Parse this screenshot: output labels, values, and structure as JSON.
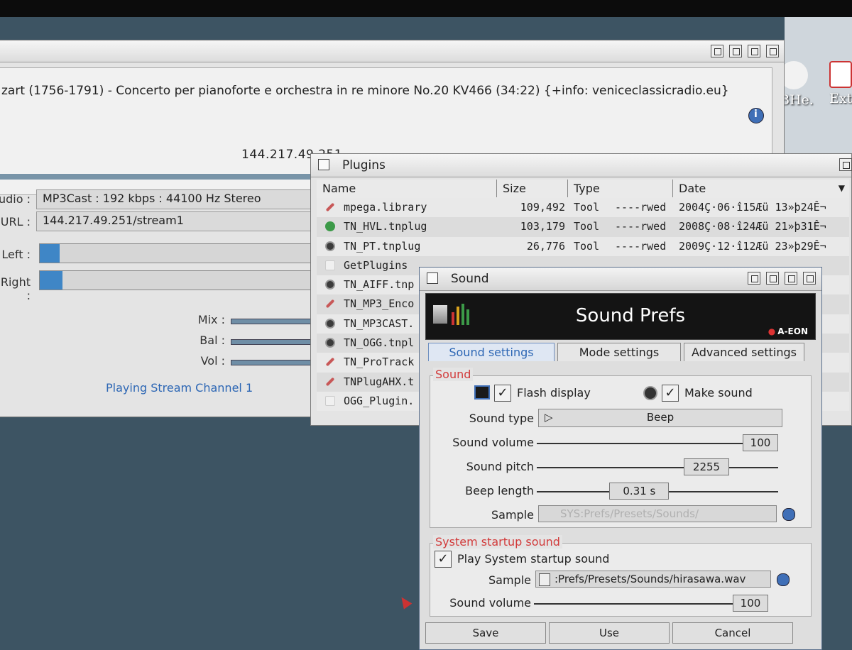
{
  "desktop": {
    "icons": [
      {
        "label": "BHe.",
        "icon": "disc-icon"
      },
      {
        "label": "Ext",
        "icon": "drawer-icon"
      }
    ]
  },
  "player": {
    "now_playing": "zart (1756-1791) - Concerto per pianoforte e orchestra in re minore No.20 KV466 (34:22)  {+info: veniceclassicradio.eu}",
    "server_ip": "144.217.49.251",
    "audio_label": "udio :",
    "audio_value": "MP3Cast : 192 kbps : 44100 Hz Stereo",
    "url_label": "URL :",
    "url_value": "144.217.49.251/stream1",
    "left_label": "Left :",
    "right_label": "Right :",
    "left_level": 0.07,
    "right_level": 0.08,
    "mix_label": "Mix :",
    "bal_label": "Bal :",
    "vol_label": "Vol :",
    "status": "Playing Stream Channel 1"
  },
  "plugins": {
    "title": "Plugins",
    "columns": {
      "name": "Name",
      "size": "Size",
      "type": "Type",
      "date": "Date"
    },
    "rows": [
      {
        "icon": "tool-icon",
        "name": "mpega.library",
        "size": "109,492",
        "type": "Tool",
        "prot": "----rwed",
        "date": "2004Ç·06·î15Æü 13»þ24Ê¬"
      },
      {
        "icon": "plugin-green-icon",
        "name": "TN_HVL.tnplug",
        "size": "103,179",
        "type": "Tool",
        "prot": "----rwed",
        "date": "2008Ç·08·î24Æü 21»þ31Ê¬"
      },
      {
        "icon": "disc-icon",
        "name": "TN_PT.tnplug",
        "size": "26,776",
        "type": "Tool",
        "prot": "----rwed",
        "date": "2009Ç·12·î12Æü 23»þ29Ê¬"
      },
      {
        "icon": "document-icon",
        "name": "GetPlugins",
        "size": "",
        "type": "",
        "prot": "",
        "date": ""
      },
      {
        "icon": "disc-icon",
        "name": "TN_AIFF.tnp",
        "size": "",
        "type": "",
        "prot": "",
        "date": ""
      },
      {
        "icon": "tool-icon",
        "name": "TN_MP3_Enco",
        "size": "",
        "type": "",
        "prot": "",
        "date": ""
      },
      {
        "icon": "disc-icon",
        "name": "TN_MP3CAST.",
        "size": "",
        "type": "",
        "prot": "",
        "date": ""
      },
      {
        "icon": "disc-icon",
        "name": "TN_OGG.tnpl",
        "size": "",
        "type": "",
        "prot": "",
        "date": ""
      },
      {
        "icon": "tool-icon",
        "name": "TN_ProTrack",
        "size": "",
        "type": "",
        "prot": "",
        "date": ""
      },
      {
        "icon": "tool-icon",
        "name": "TNPlugAHX.t",
        "size": "",
        "type": "",
        "prot": "",
        "date": ""
      },
      {
        "icon": "document-icon",
        "name": "OGG_Plugin.",
        "size": "",
        "type": "",
        "prot": "",
        "date": ""
      }
    ]
  },
  "sound": {
    "window_title": "Sound",
    "banner_title": "Sound Prefs",
    "brand": "A-EON",
    "tabs": [
      "Sound settings",
      "Mode settings",
      "Advanced settings"
    ],
    "group_sound": "Sound",
    "flash_display": "Flash display",
    "make_sound": "Make sound",
    "sound_type_label": "Sound type",
    "sound_type_value": "Beep",
    "sound_volume_label": "Sound volume",
    "sound_volume_value": "100",
    "sound_volume_level": 1.0,
    "sound_pitch_label": "Sound pitch",
    "sound_pitch_value": "2255",
    "sound_pitch_level": 0.75,
    "beep_length_label": "Beep length",
    "beep_length_value": "0.31 s",
    "beep_length_level": 0.4,
    "sample_label": "Sample",
    "sample_value": "SYS:Prefs/Presets/Sounds/",
    "group_startup": "System startup sound",
    "play_startup": "Play System startup sound",
    "startup_sample_label": "Sample",
    "startup_sample_value": ":Prefs/Presets/Sounds/hirasawa.wav",
    "startup_volume_label": "Sound volume",
    "startup_volume_value": "100",
    "startup_volume_level": 1.0,
    "save": "Save",
    "use": "Use",
    "cancel": "Cancel",
    "check_mark": "✓"
  }
}
